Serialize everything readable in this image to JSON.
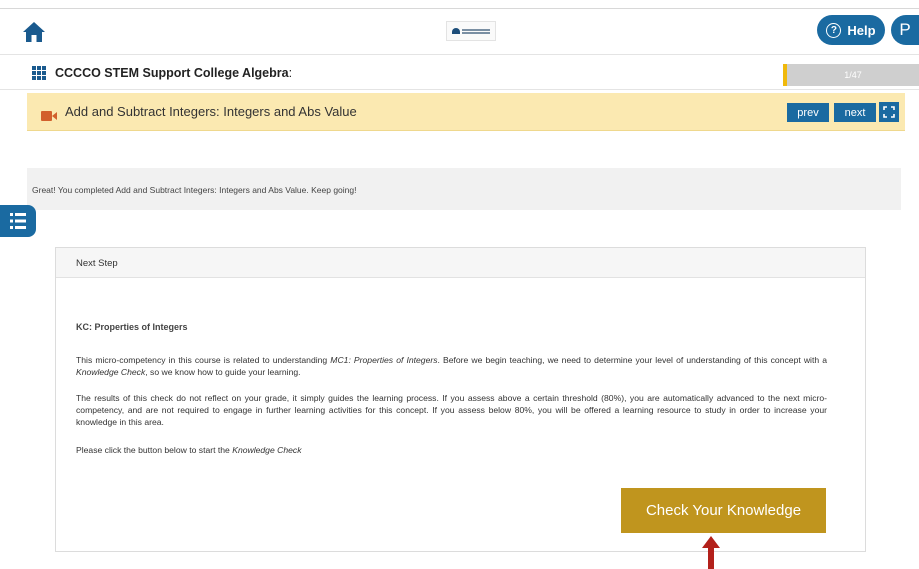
{
  "header": {
    "help_label": "Help",
    "profile_initial": "P"
  },
  "course": {
    "title": "CCCCO STEM Support College Algebra",
    "title_suffix": ":",
    "progress": "1/47"
  },
  "lesson": {
    "title": "Add and Subtract Integers: Integers and Abs Value",
    "prev_label": "prev",
    "next_label": "next"
  },
  "banner": {
    "message": "Great! You completed Add and Subtract Integers: Integers and Abs Value. Keep going!"
  },
  "next_step": {
    "header": "Next Step",
    "kc_title": "KC: Properties of Integers",
    "p1_a": "This micro-competency in this course is related to understanding ",
    "p1_em1": "MC1: Properties of Integers",
    "p1_b": ". Before we begin teaching, we need to determine your level of understanding of this concept with a ",
    "p1_em2": "Knowledge Check",
    "p1_c": ", so we know how to guide your learning.",
    "p2": "The results of this check do not reflect on your grade, it simply guides the learning process. If you assess above a certain threshold (80%), you are automatically advanced to the next micro-competency, and are not required to engage in further learning activities for this concept. If you assess below 80%, you will be offered a learning resource to study in order to increase your knowledge in this area.",
    "p3_a": "Please click the button below to start the ",
    "p3_em": "Knowledge Check",
    "button_label": "Check Your Knowledge"
  },
  "colors": {
    "primary": "#1a6aa1",
    "lesson_bar": "#fbe9b1",
    "progress_accent": "#f0b90b",
    "check_button": "#c0951e",
    "arrow": "#b3201a"
  },
  "icons": {
    "home": "home-icon",
    "grid": "grid-menu-icon",
    "video": "video-camera-icon",
    "expand": "expand-icon",
    "sidebar": "list-toggle-icon",
    "help": "question-circle-icon",
    "arrow": "arrow-up-icon"
  }
}
